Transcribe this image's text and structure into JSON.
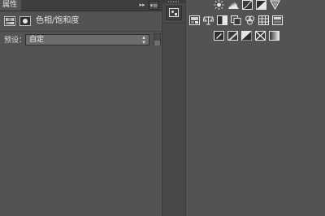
{
  "properties_panel": {
    "tab_label": "属性",
    "collapse_glyph": "▸▸",
    "menu_glyph": "▾≡",
    "adjustment_title": "色相/饱和度",
    "preset": {
      "label": "预设：",
      "value": "自定",
      "arrows": "▴▾"
    }
  },
  "dock": {
    "button_icon": "adjustments-panel-icon"
  },
  "adjustments_panel": {
    "rows": [
      [
        "brightness-contrast-icon",
        "levels-icon",
        "curves-icon",
        "exposure-icon",
        "gradient-triangle-icon"
      ],
      [
        "vibrance-icon",
        "hue-saturation-icon",
        "color-balance-icon",
        "black-white-icon",
        "photo-filter-icon",
        "channel-mixer-icon",
        "color-lookup-icon"
      ],
      [
        "invert-icon",
        "posterize-icon",
        "threshold-icon",
        "selective-color-icon",
        "gradient-map-icon"
      ]
    ]
  },
  "colors": {
    "panel_bg": "#535353",
    "header_bg": "#3e3e3e",
    "dock_bg": "#494949",
    "workspace_bg": "#595959",
    "text": "#dcdcdc"
  }
}
